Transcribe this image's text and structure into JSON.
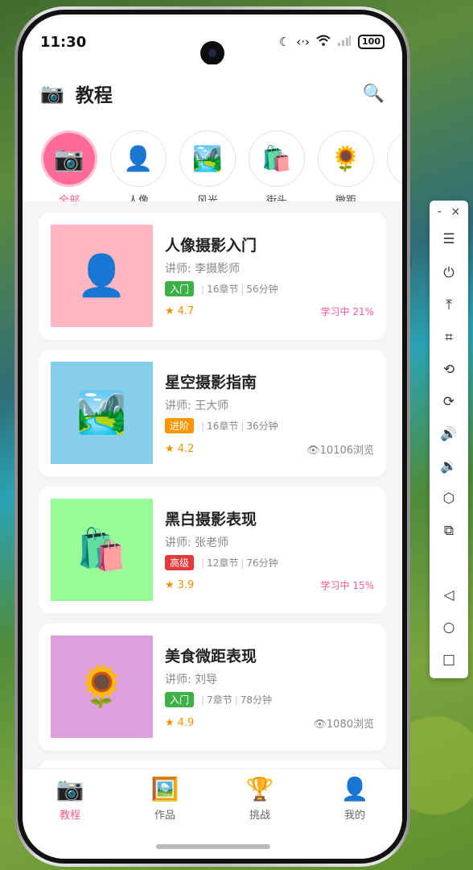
{
  "status_bar": {
    "time": "11:30",
    "battery": "100",
    "icons": [
      "moon-icon",
      "nfc-icon",
      "wifi-icon",
      "signal-icon"
    ]
  },
  "header": {
    "logo_icon": "📷",
    "title": "教程",
    "search_icon": "🔍"
  },
  "categories": [
    {
      "icon": "📷",
      "label": "全部",
      "active": true
    },
    {
      "icon": "👤",
      "label": "人像"
    },
    {
      "icon": "🏞️",
      "label": "风光"
    },
    {
      "icon": "🛍️",
      "label": "街头"
    },
    {
      "icon": "🌻",
      "label": "微距"
    },
    {
      "icon": "🍔",
      "label": ""
    }
  ],
  "courses": [
    {
      "title": "人像摄影入门",
      "teacher": "讲师: 李摄影师",
      "level": "入门",
      "level_color": "#3db047",
      "chapters": "16章节",
      "duration": "56分钟",
      "rating": "4.7",
      "status": "学习中 21%",
      "thumb_icon": "👤",
      "thumb_color": "#ffb6c1"
    },
    {
      "title": "星空摄影指南",
      "teacher": "讲师: 王大师",
      "level": "进阶",
      "level_color": "#ff9500",
      "chapters": "16章节",
      "duration": "36分钟",
      "rating": "4.2",
      "views": "10106浏览",
      "thumb_icon": "🏞️",
      "thumb_color": "#87ceeb"
    },
    {
      "title": "黑白摄影表现",
      "teacher": "讲师: 张老师",
      "level": "高级",
      "level_color": "#e5383b",
      "chapters": "12章节",
      "duration": "76分钟",
      "rating": "3.9",
      "status": "学习中 15%",
      "thumb_icon": "🛍️",
      "thumb_color": "#98fb98"
    },
    {
      "title": "美食微距表现",
      "teacher": "讲师: 刘导",
      "level": "入门",
      "level_color": "#3db047",
      "chapters": "7章节",
      "duration": "78分钟",
      "rating": "4.9",
      "views": "1080浏览",
      "thumb_icon": "🌻",
      "thumb_color": "#dda0dd"
    },
    {
      "thumb_color": "#f0e68c"
    }
  ],
  "tabbar": [
    {
      "icon": "📷",
      "label": "教程",
      "active": true
    },
    {
      "icon": "🖼️",
      "label": "作品"
    },
    {
      "icon": "🏆",
      "label": "挑战"
    },
    {
      "icon": "👤",
      "label": "我的"
    }
  ],
  "toolbar": {
    "minimize": "-",
    "close": "×",
    "items": [
      "☰",
      "⏻",
      "⤒",
      "⌗",
      "⟲",
      "⟳",
      "🔊",
      "🔉",
      "⬡",
      "⧉",
      "◁",
      "○",
      "□"
    ]
  }
}
